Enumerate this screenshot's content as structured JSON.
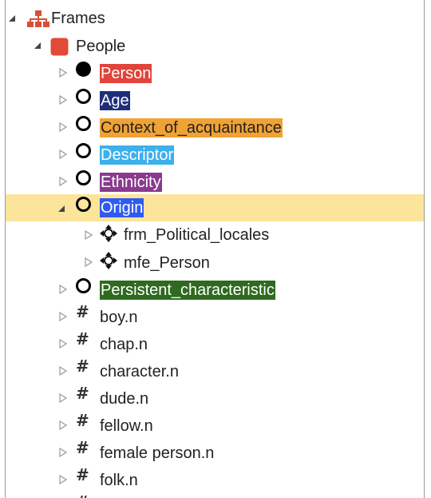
{
  "tree": {
    "root": {
      "label": "Frames",
      "icon": "hierarchy-icon",
      "color": "#d94f35",
      "expanded": true
    },
    "people": {
      "label": "People",
      "icon": "red-square-icon",
      "color": "#e04a36",
      "expanded": true
    },
    "items": [
      {
        "label": "Person",
        "icon": "filled-circle-icon",
        "highlight": "#e0443a",
        "text_color": "#ffffff",
        "expanded": false
      },
      {
        "label": "Age",
        "icon": "open-circle-icon",
        "highlight": "#1e2f7a",
        "text_color": "#ffffff",
        "expanded": false
      },
      {
        "label": "Context_of_acquaintance",
        "icon": "open-circle-icon",
        "highlight": "#f1a234",
        "text_color": "#222222",
        "expanded": false
      },
      {
        "label": "Descriptor",
        "icon": "open-circle-icon",
        "highlight": "#3cb0ec",
        "text_color": "#ffffff",
        "expanded": false
      },
      {
        "label": "Ethnicity",
        "icon": "open-circle-icon",
        "highlight": "#8a3a8e",
        "text_color": "#ffffff",
        "expanded": false
      },
      {
        "label": "Origin",
        "icon": "open-circle-icon",
        "highlight": "#2f5bf0",
        "text_color": "#ffffff",
        "expanded": true,
        "selected": true
      },
      {
        "label": "frm_Political_locales",
        "icon": "move-cross-icon",
        "child_of": "Origin",
        "expanded": false
      },
      {
        "label": "mfe_Person",
        "icon": "move-cross-icon",
        "child_of": "Origin",
        "expanded": false
      },
      {
        "label": "Persistent_characteristic",
        "icon": "open-circle-icon",
        "highlight": "#2e6a1f",
        "text_color": "#ffffff",
        "expanded": false
      },
      {
        "label": "boy.n",
        "icon": "hash-icon",
        "expanded": false
      },
      {
        "label": "chap.n",
        "icon": "hash-icon",
        "expanded": false
      },
      {
        "label": "character.n",
        "icon": "hash-icon",
        "expanded": false
      },
      {
        "label": "dude.n",
        "icon": "hash-icon",
        "expanded": false
      },
      {
        "label": "fellow.n",
        "icon": "hash-icon",
        "expanded": false
      },
      {
        "label": "female person.n",
        "icon": "hash-icon",
        "expanded": false
      },
      {
        "label": "folk.n",
        "icon": "hash-icon",
        "expanded": false
      }
    ],
    "selected_row_color": "#fce59a"
  }
}
